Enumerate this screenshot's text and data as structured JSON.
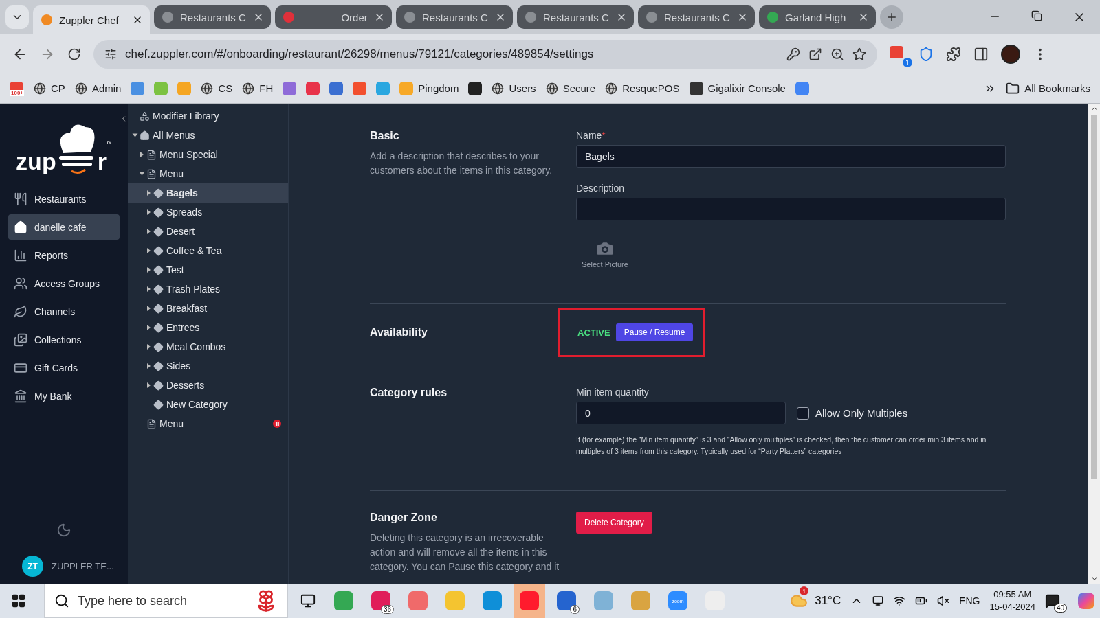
{
  "browser": {
    "tabs": [
      {
        "label": "Zuppler Chef",
        "selected": true,
        "color": "#f08a24"
      },
      {
        "label": "Restaurants C",
        "selected": false,
        "color": "#8a8e93"
      },
      {
        "label": "_______Order",
        "selected": false,
        "color": "#e0303a"
      },
      {
        "label": "Restaurants C",
        "selected": false,
        "color": "#8a8e93"
      },
      {
        "label": "Restaurants C",
        "selected": false,
        "color": "#8a8e93"
      },
      {
        "label": "Restaurants C",
        "selected": false,
        "color": "#8a8e93"
      },
      {
        "label": "Garland High",
        "selected": false,
        "color": "#34a853"
      }
    ],
    "address": "chef.zuppler.com/#/onboarding/restaurant/26298/menus/79121/categories/489854/settings",
    "extension_badge": "1",
    "bookmarks": [
      {
        "kind": "app",
        "color": "#e94235",
        "badge": "100+"
      },
      {
        "kind": "globe",
        "label": "CP"
      },
      {
        "kind": "globe",
        "label": "Admin"
      },
      {
        "kind": "app",
        "color": "#4a90e2"
      },
      {
        "kind": "app",
        "color": "#7cc242"
      },
      {
        "kind": "app",
        "color": "#f5a623"
      },
      {
        "kind": "globe",
        "label": "CS"
      },
      {
        "kind": "globe",
        "label": "FH"
      },
      {
        "kind": "app",
        "color": "#8e6bd8"
      },
      {
        "kind": "app",
        "color": "#e8334a"
      },
      {
        "kind": "app",
        "color": "#3b6fd1"
      },
      {
        "kind": "app",
        "color": "#f2502f"
      },
      {
        "kind": "app",
        "color": "#2aa7e0"
      },
      {
        "kind": "app",
        "color": "#f7a928",
        "label": "Pingdom"
      },
      {
        "kind": "app",
        "color": "#222222"
      },
      {
        "kind": "globe",
        "label": "Users"
      },
      {
        "kind": "globe",
        "label": "Secure"
      },
      {
        "kind": "globe",
        "label": "ResquePOS"
      },
      {
        "kind": "app",
        "color": "#333333",
        "label": "Gigalixir Console"
      },
      {
        "kind": "app",
        "color": "#4285f4"
      }
    ],
    "all_bookmarks": "All Bookmarks"
  },
  "app": {
    "logo": {
      "prefix": "zup",
      "suffix": "r",
      "mark": "™"
    },
    "nav": [
      {
        "label": "Restaurants",
        "selected": false
      },
      {
        "label": "danelle cafe",
        "selected": true
      },
      {
        "label": "Reports",
        "selected": false
      },
      {
        "label": "Access Groups",
        "selected": false
      },
      {
        "label": "Channels",
        "selected": false
      },
      {
        "label": "Collections",
        "selected": false
      },
      {
        "label": "Gift Cards",
        "selected": false
      },
      {
        "label": "My Bank",
        "selected": false
      }
    ],
    "user": {
      "initials": "ZT",
      "name": "ZUPPLER TE..."
    },
    "tree": [
      {
        "label": "Modifier Library",
        "kind": "library",
        "selected": false
      },
      {
        "label": "All Menus",
        "kind": "root",
        "expanded": true,
        "selected": false,
        "children": [
          {
            "label": "Menu Special",
            "kind": "menu",
            "expanded": false,
            "selected": false
          },
          {
            "label": "Menu",
            "kind": "menu",
            "expanded": true,
            "selected": false,
            "children": [
              {
                "label": "Bagels",
                "kind": "category",
                "expanded": false,
                "selected": true
              },
              {
                "label": "Spreads",
                "kind": "category",
                "expanded": false,
                "selected": false
              },
              {
                "label": "Desert",
                "kind": "category",
                "expanded": false,
                "selected": false
              },
              {
                "label": "Coffee & Tea",
                "kind": "category",
                "expanded": false,
                "selected": false
              },
              {
                "label": "Test",
                "kind": "category",
                "expanded": false,
                "selected": false
              },
              {
                "label": "Trash Plates",
                "kind": "category",
                "expanded": false,
                "selected": false
              },
              {
                "label": "Breakfast",
                "kind": "category",
                "expanded": false,
                "selected": false
              },
              {
                "label": "Entrees",
                "kind": "category",
                "expanded": false,
                "selected": false
              },
              {
                "label": "Meal Combos",
                "kind": "category",
                "expanded": false,
                "selected": false
              },
              {
                "label": "Sides",
                "kind": "category",
                "expanded": false,
                "selected": false
              },
              {
                "label": "Desserts",
                "kind": "category",
                "expanded": false,
                "selected": false
              },
              {
                "label": "New Category",
                "kind": "category",
                "selected": false
              }
            ]
          },
          {
            "label": "Menu",
            "kind": "menu",
            "selected": false,
            "paused": true
          }
        ]
      }
    ],
    "sections": [
      {
        "kind": "basic",
        "title": "Basic",
        "description": "Add a description that describes to your customers about the items in this category.",
        "name_label": "Name",
        "required_mark": "*",
        "name_value": "Bagels",
        "description_label": "Description",
        "picture_label": "Select Picture"
      },
      {
        "kind": "availability",
        "title": "Availability",
        "status": "ACTIVE",
        "button": "Pause / Resume",
        "highlighted": true
      },
      {
        "kind": "rules",
        "title": "Category rules",
        "field_label": "Min item quantity",
        "field_value": "0",
        "checkbox_label": "Allow Only Multiples",
        "checked": false,
        "help": "If (for example) the “Min item quantity” is 3 and “Allow only multiples” is checked, then the customer can order min 3 items and in multiples of 3 items from this category. Typically used for “Party Platters” categories"
      },
      {
        "kind": "danger",
        "title": "Danger Zone",
        "description": "Deleting this category is an irrecoverable action and will remove all the items in this category. You can Pause this category and it",
        "button": "Delete Category"
      }
    ]
  },
  "taskbar": {
    "search_placeholder": "Type here to search",
    "apps": [
      {
        "color": "#34a853",
        "selected": false
      },
      {
        "color": "#e01e5a",
        "badge": "36",
        "selected": false
      },
      {
        "color": "#f06a6a",
        "selected": false
      },
      {
        "color": "#f4c430",
        "selected": false
      },
      {
        "color": "#0f8fd8",
        "selected": false
      },
      {
        "color": "#ff1b2d",
        "selected": true
      },
      {
        "color": "#2564cf",
        "badge": "6",
        "selected": false
      },
      {
        "color": "#7fb2d6",
        "selected": false
      },
      {
        "color": "#d9a441",
        "selected": false
      },
      {
        "color": "#2d8cff",
        "label": "zoom",
        "selected": false
      },
      {
        "color": "#eeeeee",
        "selected": false
      }
    ],
    "weather_badge": "1",
    "temperature": "31°C",
    "language": "ENG",
    "time": "09:55 AM",
    "date": "15-04-2024",
    "notifications": "40"
  }
}
